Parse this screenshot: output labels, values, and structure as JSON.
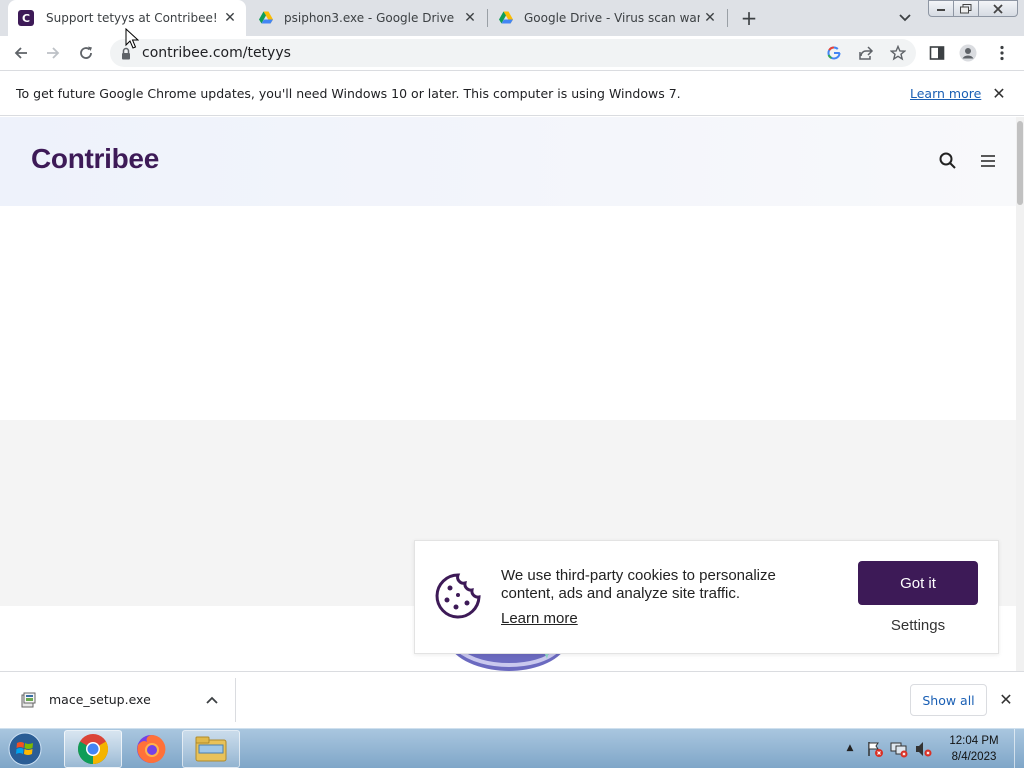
{
  "browser": {
    "tabs": [
      {
        "title": "Support tetyys at Contribee!",
        "favicon": "contribee-c-icon",
        "active": true
      },
      {
        "title": "psiphon3.exe - Google Drive",
        "favicon": "google-drive-icon",
        "active": false
      },
      {
        "title": "Google Drive - Virus scan warnin",
        "favicon": "google-drive-icon",
        "active": false
      }
    ],
    "favicon_letter": "C",
    "new_tab_label": "+",
    "address": "contribee.com/tetyys"
  },
  "infobar": {
    "message": "To get future Google Chrome updates, you'll need Windows 10 or later. This computer is using Windows 7.",
    "learn_more": "Learn more"
  },
  "site": {
    "logo": "Contribee",
    "brand_color": "#3d1a57"
  },
  "cookie_banner": {
    "message": "We use third-party cookies to personalize content, ads and analyze site traffic.",
    "learn_more": "Learn more",
    "accept_label": "Got it",
    "settings_label": "Settings"
  },
  "downloads": {
    "file_name": "mace_setup.exe",
    "show_all_label": "Show all"
  },
  "taskbar": {
    "apps": [
      "chrome-icon",
      "firefox-icon",
      "windows-explorer-icon"
    ],
    "time": "12:04 PM",
    "date": "8/4/2023"
  }
}
